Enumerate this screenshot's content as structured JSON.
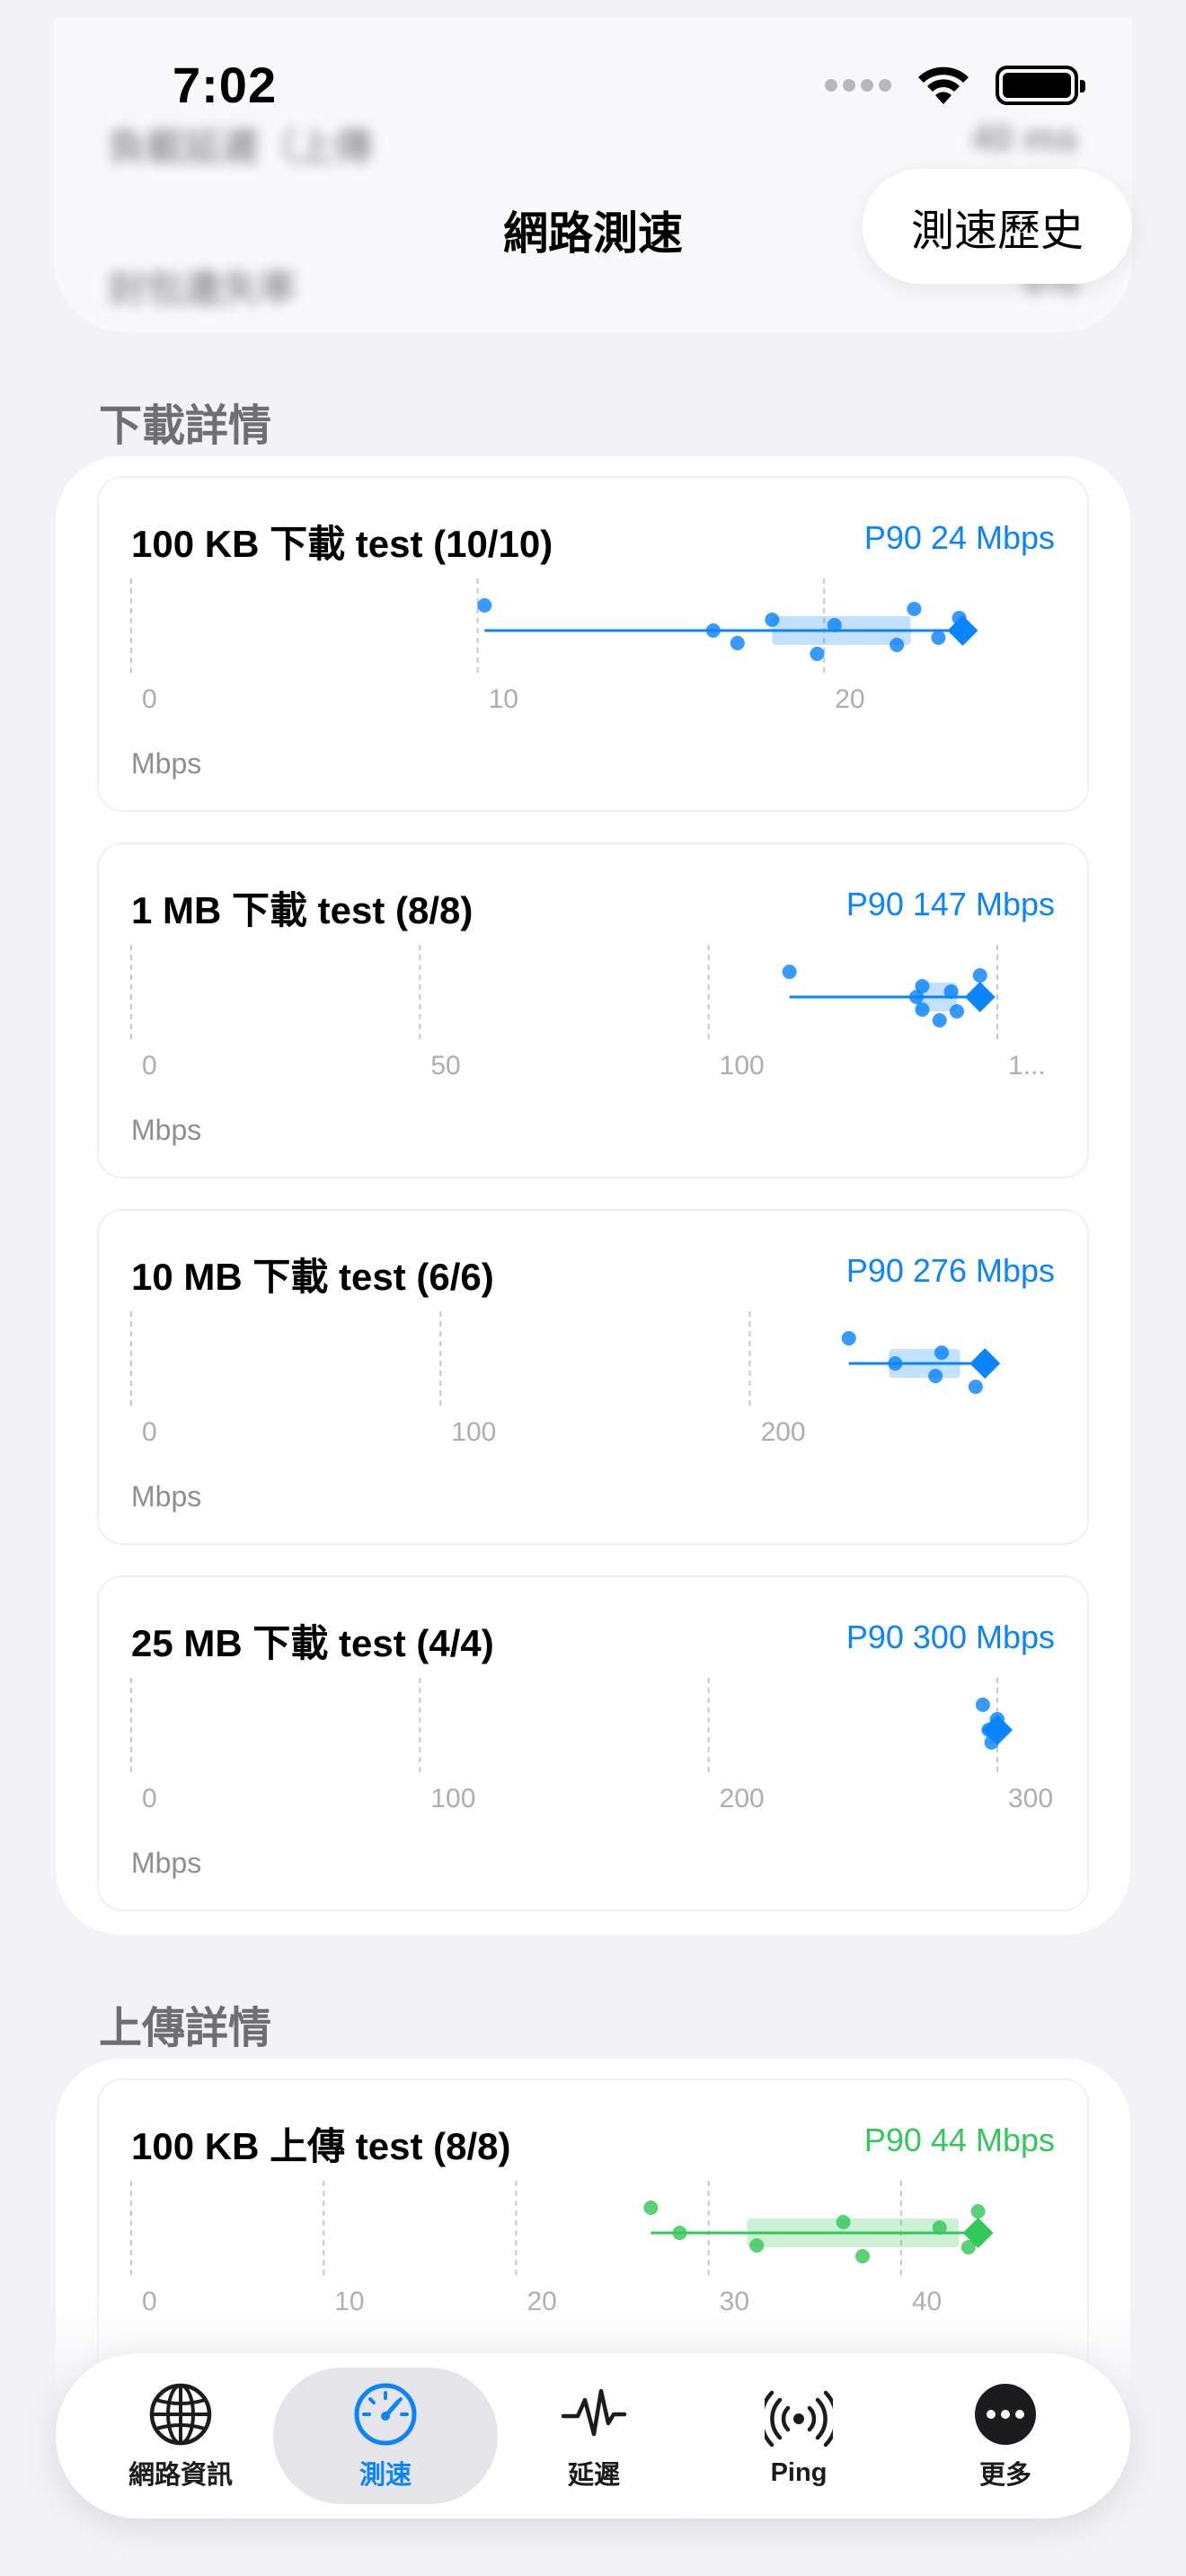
{
  "status": {
    "time": "7:02"
  },
  "header": {
    "title": "網路測速",
    "history_button": "測速歷史",
    "blurred_rows": [
      {
        "label": "負載延遲（上傳",
        "value": "40 ms"
      },
      {
        "label": "封包遺失率",
        "value": "0%"
      }
    ]
  },
  "download": {
    "section_title": "下載詳情",
    "unit": "Mbps",
    "tests": [
      {
        "title": "100 KB 下載 test (10/10)",
        "p90": "P90 24 Mbps",
        "ticks": [
          "0",
          "10",
          "20"
        ]
      },
      {
        "title": "1 MB 下載 test (8/8)",
        "p90": "P90 147 Mbps",
        "ticks": [
          "0",
          "50",
          "100",
          "1..."
        ]
      },
      {
        "title": "10 MB 下載 test (6/6)",
        "p90": "P90 276 Mbps",
        "ticks": [
          "0",
          "100",
          "200"
        ]
      },
      {
        "title": "25 MB 下載 test (4/4)",
        "p90": "P90 300 Mbps",
        "ticks": [
          "0",
          "100",
          "200",
          "300"
        ]
      }
    ]
  },
  "upload": {
    "section_title": "上傳詳情",
    "tests": [
      {
        "title": "100 KB 上傳 test (8/8)",
        "p90": "P90 44 Mbps",
        "ticks": [
          "0",
          "10",
          "20",
          "30",
          "40"
        ]
      }
    ]
  },
  "chart_data": [
    {
      "type": "scatter",
      "title": "100 KB 下載 test (10/10)",
      "xlabel": "Mbps",
      "xlim": [
        0,
        25
      ],
      "x_ticks": [
        0,
        10,
        20
      ],
      "series": [
        {
          "values": [
            10.2,
            16.8,
            17.5,
            18.5,
            19.8,
            20.3,
            22.1,
            22.6,
            23.3,
            23.9
          ]
        }
      ],
      "p90": 24,
      "iqr": [
        18.5,
        22.5
      ]
    },
    {
      "type": "scatter",
      "title": "1 MB 下載 test (8/8)",
      "xlabel": "Mbps",
      "xlim": [
        0,
        150
      ],
      "x_ticks": [
        0,
        50,
        100,
        150
      ],
      "series": [
        {
          "values": [
            114,
            136,
            137,
            137,
            140,
            142,
            143,
            147
          ]
        }
      ],
      "p90": 147,
      "iqr": [
        136,
        143
      ]
    },
    {
      "type": "scatter",
      "title": "10 MB 下載 test (6/6)",
      "xlabel": "Mbps",
      "xlim": [
        0,
        280
      ],
      "x_ticks": [
        0,
        100,
        200
      ],
      "series": [
        {
          "values": [
            232,
            247,
            260,
            262,
            273,
            276
          ]
        }
      ],
      "p90": 276,
      "iqr": [
        245,
        268
      ]
    },
    {
      "type": "scatter",
      "title": "25 MB 下載 test (4/4)",
      "xlabel": "Mbps",
      "xlim": [
        0,
        300
      ],
      "x_ticks": [
        0,
        100,
        200,
        300
      ],
      "series": [
        {
          "values": [
            295,
            297,
            298,
            300
          ]
        }
      ],
      "p90": 300,
      "iqr": [
        297,
        299
      ]
    },
    {
      "type": "scatter",
      "title": "100 KB 上傳 test (8/8)",
      "xlabel": "Mbps",
      "xlim": [
        0,
        45
      ],
      "x_ticks": [
        0,
        10,
        20,
        30,
        40
      ],
      "series": [
        {
          "values": [
            27.0,
            28.5,
            32.5,
            37.0,
            38.0,
            42.0,
            43.5,
            44.0
          ]
        }
      ],
      "p90": 44,
      "iqr": [
        32,
        43
      ]
    }
  ],
  "colors": {
    "download": "#0a84ff",
    "upload": "#34c759",
    "background": "#f2f2f7"
  },
  "tabs": [
    {
      "label": "網路資訊",
      "icon": "globe-icon"
    },
    {
      "label": "測速",
      "icon": "speedometer-icon",
      "active": true
    },
    {
      "label": "延遲",
      "icon": "waveform-icon"
    },
    {
      "label": "Ping",
      "icon": "antenna-icon"
    },
    {
      "label": "更多",
      "icon": "ellipsis-icon"
    }
  ]
}
